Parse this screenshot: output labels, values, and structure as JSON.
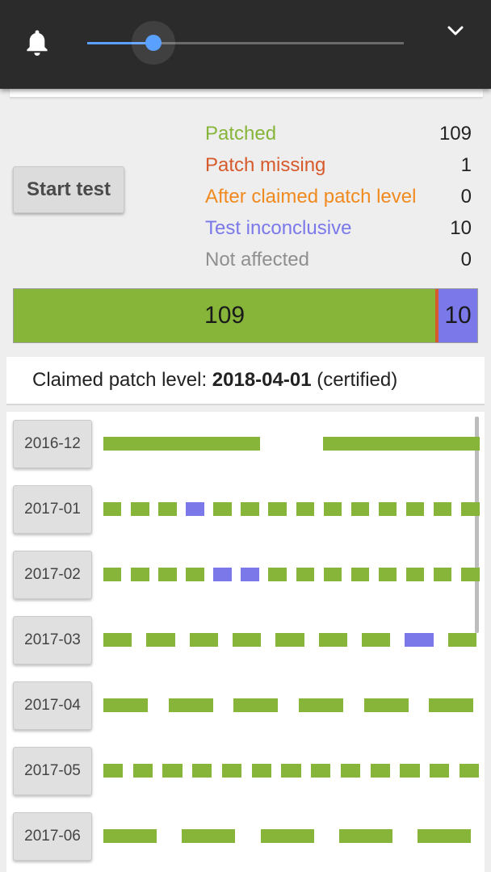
{
  "colors": {
    "patched": "#86b53a",
    "missing": "#d65a2c",
    "after": "#f08a1e",
    "inconclusive": "#7b78ea",
    "not_affected": "#8f8f8f",
    "accent": "#5aa0ff"
  },
  "topbar": {
    "bell_icon": "bell-icon",
    "volume_level": 0.21,
    "chevron_icon": "chevron-down-icon"
  },
  "start_button": {
    "label": "Start test"
  },
  "stats": [
    {
      "label": "Patched",
      "value": "109",
      "color": "#86b53a"
    },
    {
      "label": "Patch missing",
      "value": "1",
      "color": "#d65a2c"
    },
    {
      "label": "After claimed patch level",
      "value": "0",
      "color": "#f08a1e"
    },
    {
      "label": "Test inconclusive",
      "value": "10",
      "color": "#7b78ea"
    },
    {
      "label": "Not affected",
      "value": "0",
      "color": "#8f8f8f"
    }
  ],
  "summary_bar": {
    "segments": [
      {
        "name": "patched",
        "count": 109,
        "label": "109",
        "color": "#86b53a"
      },
      {
        "name": "missing",
        "count": 1,
        "label": "",
        "color": "#d65a2c"
      },
      {
        "name": "inconclusive",
        "count": 10,
        "label": "10",
        "color": "#7b78ea"
      }
    ]
  },
  "claimed": {
    "prefix": "Claimed patch level: ",
    "date": "2018-04-01",
    "suffix": " (certified)"
  },
  "months": [
    {
      "label": "2016-12",
      "tests": [
        "p",
        "g",
        "p"
      ]
    },
    {
      "label": "2017-01",
      "tests": [
        "p",
        "p",
        "p",
        "i",
        "p",
        "p",
        "p",
        "p",
        "p",
        "p",
        "p",
        "p",
        "p",
        "p"
      ]
    },
    {
      "label": "2017-02",
      "tests": [
        "p",
        "p",
        "p",
        "p",
        "i",
        "i",
        "p",
        "p",
        "p",
        "p",
        "p",
        "p",
        "p",
        "p"
      ]
    },
    {
      "label": "2017-03",
      "tests": [
        "p",
        "p",
        "p",
        "p",
        "p",
        "p",
        "p",
        "i",
        "p"
      ]
    },
    {
      "label": "2017-04",
      "tests": [
        "p",
        "p",
        "p",
        "p",
        "p",
        "p"
      ]
    },
    {
      "label": "2017-05",
      "tests": [
        "p",
        "p",
        "p",
        "p",
        "p",
        "p",
        "p",
        "p",
        "p",
        "p",
        "p",
        "p",
        "p"
      ]
    },
    {
      "label": "2017-06",
      "tests": [
        "p",
        "p",
        "p",
        "p",
        "p"
      ]
    }
  ]
}
